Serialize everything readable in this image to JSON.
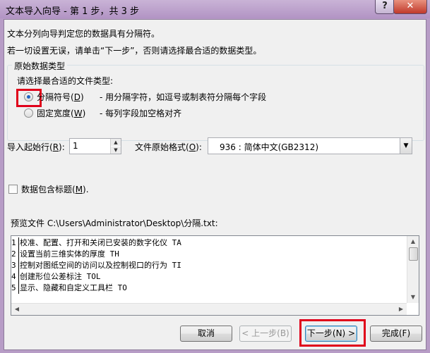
{
  "window": {
    "title": "文本导入向导 - 第 1 步，共 3 步",
    "help_label": "?",
    "close_label": "✕"
  },
  "intro": {
    "line1": "文本分列向导判定您的数据具有分隔符。",
    "line2": "若一切设置无误，请单击“下一步”，否则请选择最合适的数据类型。"
  },
  "original_type_group": {
    "legend": "原始数据类型",
    "prompt": "请选择最合适的文件类型:",
    "options": [
      {
        "label": "分隔符号(",
        "key": "D",
        "close": ")",
        "desc": "- 用分隔字符，如逗号或制表符分隔每个字段",
        "checked": true
      },
      {
        "label": "固定宽度(",
        "key": "W",
        "close": ")",
        "desc": "- 每列字段加空格对齐",
        "checked": false
      }
    ]
  },
  "start_row": {
    "label": "导入起始行(",
    "key": "R",
    "close": "):",
    "value": "1"
  },
  "file_origin": {
    "label": "文件原始格式(",
    "key": "O",
    "close": "):",
    "value": "936 : 简体中文(GB2312)"
  },
  "headers_checkbox": {
    "label": "数据包含标题(",
    "key": "M",
    "close": ").",
    "checked": false
  },
  "preview": {
    "label": "预览文件 C:\\Users\\Administrator\\Desktop\\分隔.txt:",
    "rows": [
      {
        "n": "1",
        "text": "校准、配置、打开和关闭已安装的数字化仪 TA"
      },
      {
        "n": "2",
        "text": "设置当前三维实体的厚度 TH"
      },
      {
        "n": "3",
        "text": "控制对图纸空间的访问以及控制视口的行为 TI"
      },
      {
        "n": "4",
        "text": "创建形位公差标注 TOL"
      },
      {
        "n": "5",
        "text": "显示、隐藏和自定义工具栏 TO"
      }
    ]
  },
  "buttons": {
    "cancel": "取消",
    "back": "< 上一步(B)",
    "next": "下一步(N) >",
    "finish": "完成(F)"
  },
  "colors": {
    "highlight": "#e0001a",
    "accent": "#1f64c2"
  }
}
